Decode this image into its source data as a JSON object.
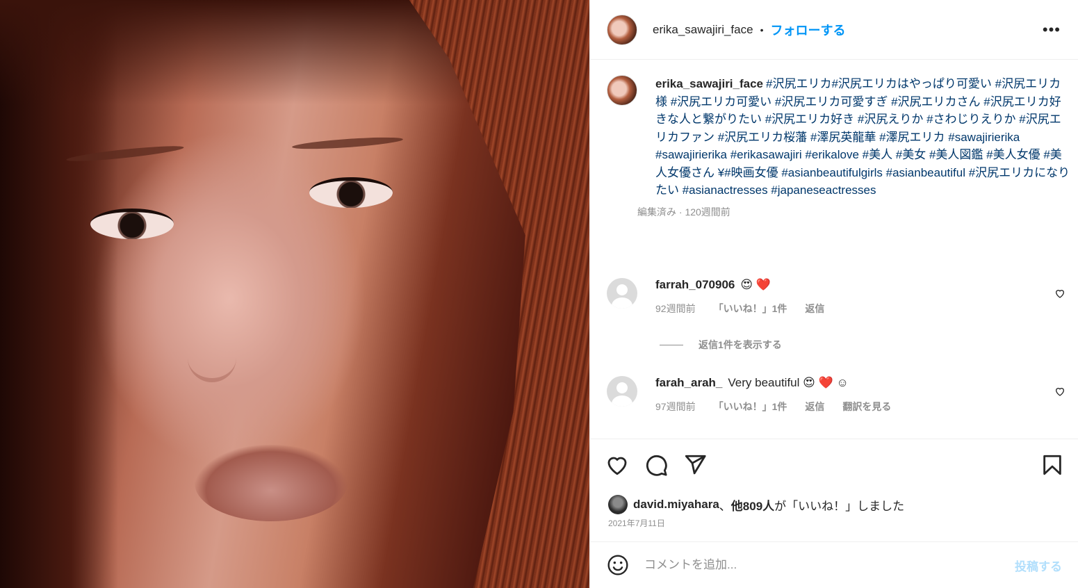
{
  "post": {
    "username": "erika_sawajiri_face",
    "dot": "•",
    "follow_label": "フォローする",
    "more_label": "•••"
  },
  "caption": {
    "username": "erika_sawajiri_face",
    "text": "#沢尻エリカ#沢尻エリカはやっぱり可愛い #沢尻エリカ様 #沢尻エリカ可愛い #沢尻エリカ可愛すぎ #沢尻エリカさん #沢尻エリカ好きな人と繋がりたい #沢尻エリカ好き #沢尻えりか #さわじりえりか #沢尻エリカファン #沢尻エリカ桜藩 #澤尻英龍華 #澤尻エリカ #sawajirierika #sawajirierika #erikasawajiri #erikalove #美人 #美女 #美人図鑑 #美人女優 #美人女優さん ¥#映画女優 #asianbeautifulgirls #asianbeautiful #沢尻エリカになりたい #asianactresses #japaneseactresses",
    "meta": "編集済み · 120週間前"
  },
  "comments": [
    {
      "username": "farrah_070906",
      "text": "😍 ❤️",
      "time": "92週間前",
      "likes": "「いいね！」1件",
      "reply": "返信",
      "translate": ""
    },
    {
      "username": "farah_arah_",
      "text": "Very beautiful 😍 ❤️ ☺",
      "time": "97週間前",
      "likes": "「いいね！」1件",
      "reply": "返信",
      "translate": "翻訳を見る"
    }
  ],
  "replies_label": "返信1件を表示する",
  "likes": {
    "user": "david.miyahara",
    "sep": "、",
    "others": "他809人",
    "suffix": "が「いいね！」しました"
  },
  "date": "2021年7月11日",
  "add_comment": {
    "placeholder": "コメントを追加...",
    "post_label": "投稿する"
  },
  "icons": {
    "like": "heart-icon",
    "comment": "comment-icon",
    "share": "send-icon",
    "save": "bookmark-icon",
    "emoji": "smiley-icon"
  },
  "colors": {
    "accent": "#0095f6",
    "post_disabled": "#b2dffc",
    "link": "#00376b",
    "muted": "#8e8e8e"
  }
}
